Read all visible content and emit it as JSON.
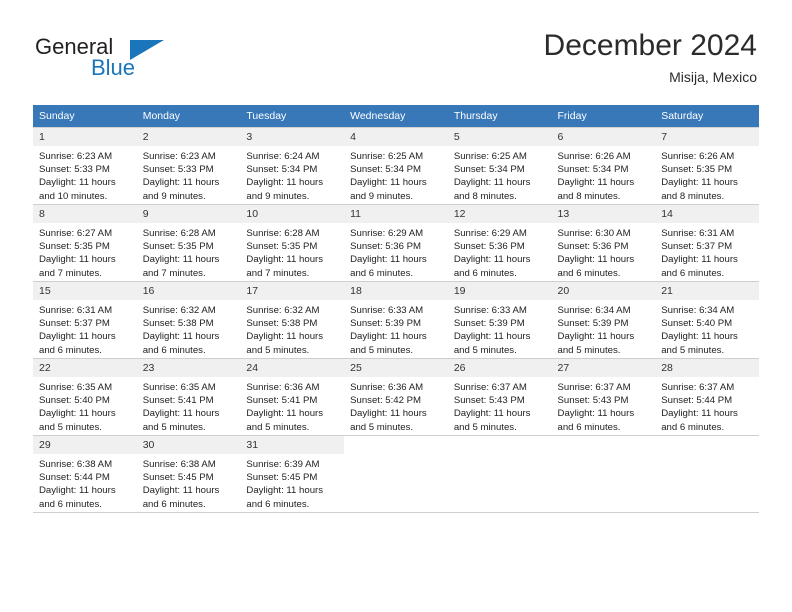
{
  "brand": {
    "name_part1": "General",
    "name_part2": "Blue",
    "accent_color": "#1b75bb",
    "logo_icon": "triangle-flag-icon"
  },
  "header": {
    "title": "December 2024",
    "subtitle": "Misija, Mexico"
  },
  "theme": {
    "header_row_bg": "#3878b9",
    "daynum_bg": "#f0f0f0",
    "grid_line": "#cfcfcf",
    "text": "#222222"
  },
  "weekday_headers": [
    "Sunday",
    "Monday",
    "Tuesday",
    "Wednesday",
    "Thursday",
    "Friday",
    "Saturday"
  ],
  "labels": {
    "sunrise_prefix": "Sunrise:",
    "sunset_prefix": "Sunset:",
    "daylight_prefix": "Daylight:"
  },
  "weeks": [
    [
      {
        "day": "1",
        "sunrise": "Sunrise: 6:23 AM",
        "sunset": "Sunset: 5:33 PM",
        "daylight1": "Daylight: 11 hours",
        "daylight2": "and 10 minutes."
      },
      {
        "day": "2",
        "sunrise": "Sunrise: 6:23 AM",
        "sunset": "Sunset: 5:33 PM",
        "daylight1": "Daylight: 11 hours",
        "daylight2": "and 9 minutes."
      },
      {
        "day": "3",
        "sunrise": "Sunrise: 6:24 AM",
        "sunset": "Sunset: 5:34 PM",
        "daylight1": "Daylight: 11 hours",
        "daylight2": "and 9 minutes."
      },
      {
        "day": "4",
        "sunrise": "Sunrise: 6:25 AM",
        "sunset": "Sunset: 5:34 PM",
        "daylight1": "Daylight: 11 hours",
        "daylight2": "and 9 minutes."
      },
      {
        "day": "5",
        "sunrise": "Sunrise: 6:25 AM",
        "sunset": "Sunset: 5:34 PM",
        "daylight1": "Daylight: 11 hours",
        "daylight2": "and 8 minutes."
      },
      {
        "day": "6",
        "sunrise": "Sunrise: 6:26 AM",
        "sunset": "Sunset: 5:34 PM",
        "daylight1": "Daylight: 11 hours",
        "daylight2": "and 8 minutes."
      },
      {
        "day": "7",
        "sunrise": "Sunrise: 6:26 AM",
        "sunset": "Sunset: 5:35 PM",
        "daylight1": "Daylight: 11 hours",
        "daylight2": "and 8 minutes."
      }
    ],
    [
      {
        "day": "8",
        "sunrise": "Sunrise: 6:27 AM",
        "sunset": "Sunset: 5:35 PM",
        "daylight1": "Daylight: 11 hours",
        "daylight2": "and 7 minutes."
      },
      {
        "day": "9",
        "sunrise": "Sunrise: 6:28 AM",
        "sunset": "Sunset: 5:35 PM",
        "daylight1": "Daylight: 11 hours",
        "daylight2": "and 7 minutes."
      },
      {
        "day": "10",
        "sunrise": "Sunrise: 6:28 AM",
        "sunset": "Sunset: 5:35 PM",
        "daylight1": "Daylight: 11 hours",
        "daylight2": "and 7 minutes."
      },
      {
        "day": "11",
        "sunrise": "Sunrise: 6:29 AM",
        "sunset": "Sunset: 5:36 PM",
        "daylight1": "Daylight: 11 hours",
        "daylight2": "and 6 minutes."
      },
      {
        "day": "12",
        "sunrise": "Sunrise: 6:29 AM",
        "sunset": "Sunset: 5:36 PM",
        "daylight1": "Daylight: 11 hours",
        "daylight2": "and 6 minutes."
      },
      {
        "day": "13",
        "sunrise": "Sunrise: 6:30 AM",
        "sunset": "Sunset: 5:36 PM",
        "daylight1": "Daylight: 11 hours",
        "daylight2": "and 6 minutes."
      },
      {
        "day": "14",
        "sunrise": "Sunrise: 6:31 AM",
        "sunset": "Sunset: 5:37 PM",
        "daylight1": "Daylight: 11 hours",
        "daylight2": "and 6 minutes."
      }
    ],
    [
      {
        "day": "15",
        "sunrise": "Sunrise: 6:31 AM",
        "sunset": "Sunset: 5:37 PM",
        "daylight1": "Daylight: 11 hours",
        "daylight2": "and 6 minutes."
      },
      {
        "day": "16",
        "sunrise": "Sunrise: 6:32 AM",
        "sunset": "Sunset: 5:38 PM",
        "daylight1": "Daylight: 11 hours",
        "daylight2": "and 6 minutes."
      },
      {
        "day": "17",
        "sunrise": "Sunrise: 6:32 AM",
        "sunset": "Sunset: 5:38 PM",
        "daylight1": "Daylight: 11 hours",
        "daylight2": "and 5 minutes."
      },
      {
        "day": "18",
        "sunrise": "Sunrise: 6:33 AM",
        "sunset": "Sunset: 5:39 PM",
        "daylight1": "Daylight: 11 hours",
        "daylight2": "and 5 minutes."
      },
      {
        "day": "19",
        "sunrise": "Sunrise: 6:33 AM",
        "sunset": "Sunset: 5:39 PM",
        "daylight1": "Daylight: 11 hours",
        "daylight2": "and 5 minutes."
      },
      {
        "day": "20",
        "sunrise": "Sunrise: 6:34 AM",
        "sunset": "Sunset: 5:39 PM",
        "daylight1": "Daylight: 11 hours",
        "daylight2": "and 5 minutes."
      },
      {
        "day": "21",
        "sunrise": "Sunrise: 6:34 AM",
        "sunset": "Sunset: 5:40 PM",
        "daylight1": "Daylight: 11 hours",
        "daylight2": "and 5 minutes."
      }
    ],
    [
      {
        "day": "22",
        "sunrise": "Sunrise: 6:35 AM",
        "sunset": "Sunset: 5:40 PM",
        "daylight1": "Daylight: 11 hours",
        "daylight2": "and 5 minutes."
      },
      {
        "day": "23",
        "sunrise": "Sunrise: 6:35 AM",
        "sunset": "Sunset: 5:41 PM",
        "daylight1": "Daylight: 11 hours",
        "daylight2": "and 5 minutes."
      },
      {
        "day": "24",
        "sunrise": "Sunrise: 6:36 AM",
        "sunset": "Sunset: 5:41 PM",
        "daylight1": "Daylight: 11 hours",
        "daylight2": "and 5 minutes."
      },
      {
        "day": "25",
        "sunrise": "Sunrise: 6:36 AM",
        "sunset": "Sunset: 5:42 PM",
        "daylight1": "Daylight: 11 hours",
        "daylight2": "and 5 minutes."
      },
      {
        "day": "26",
        "sunrise": "Sunrise: 6:37 AM",
        "sunset": "Sunset: 5:43 PM",
        "daylight1": "Daylight: 11 hours",
        "daylight2": "and 5 minutes."
      },
      {
        "day": "27",
        "sunrise": "Sunrise: 6:37 AM",
        "sunset": "Sunset: 5:43 PM",
        "daylight1": "Daylight: 11 hours",
        "daylight2": "and 6 minutes."
      },
      {
        "day": "28",
        "sunrise": "Sunrise: 6:37 AM",
        "sunset": "Sunset: 5:44 PM",
        "daylight1": "Daylight: 11 hours",
        "daylight2": "and 6 minutes."
      }
    ],
    [
      {
        "day": "29",
        "sunrise": "Sunrise: 6:38 AM",
        "sunset": "Sunset: 5:44 PM",
        "daylight1": "Daylight: 11 hours",
        "daylight2": "and 6 minutes."
      },
      {
        "day": "30",
        "sunrise": "Sunrise: 6:38 AM",
        "sunset": "Sunset: 5:45 PM",
        "daylight1": "Daylight: 11 hours",
        "daylight2": "and 6 minutes."
      },
      {
        "day": "31",
        "sunrise": "Sunrise: 6:39 AM",
        "sunset": "Sunset: 5:45 PM",
        "daylight1": "Daylight: 11 hours",
        "daylight2": "and 6 minutes."
      },
      {
        "day": "",
        "sunrise": "",
        "sunset": "",
        "daylight1": "",
        "daylight2": ""
      },
      {
        "day": "",
        "sunrise": "",
        "sunset": "",
        "daylight1": "",
        "daylight2": ""
      },
      {
        "day": "",
        "sunrise": "",
        "sunset": "",
        "daylight1": "",
        "daylight2": ""
      },
      {
        "day": "",
        "sunrise": "",
        "sunset": "",
        "daylight1": "",
        "daylight2": ""
      }
    ]
  ]
}
